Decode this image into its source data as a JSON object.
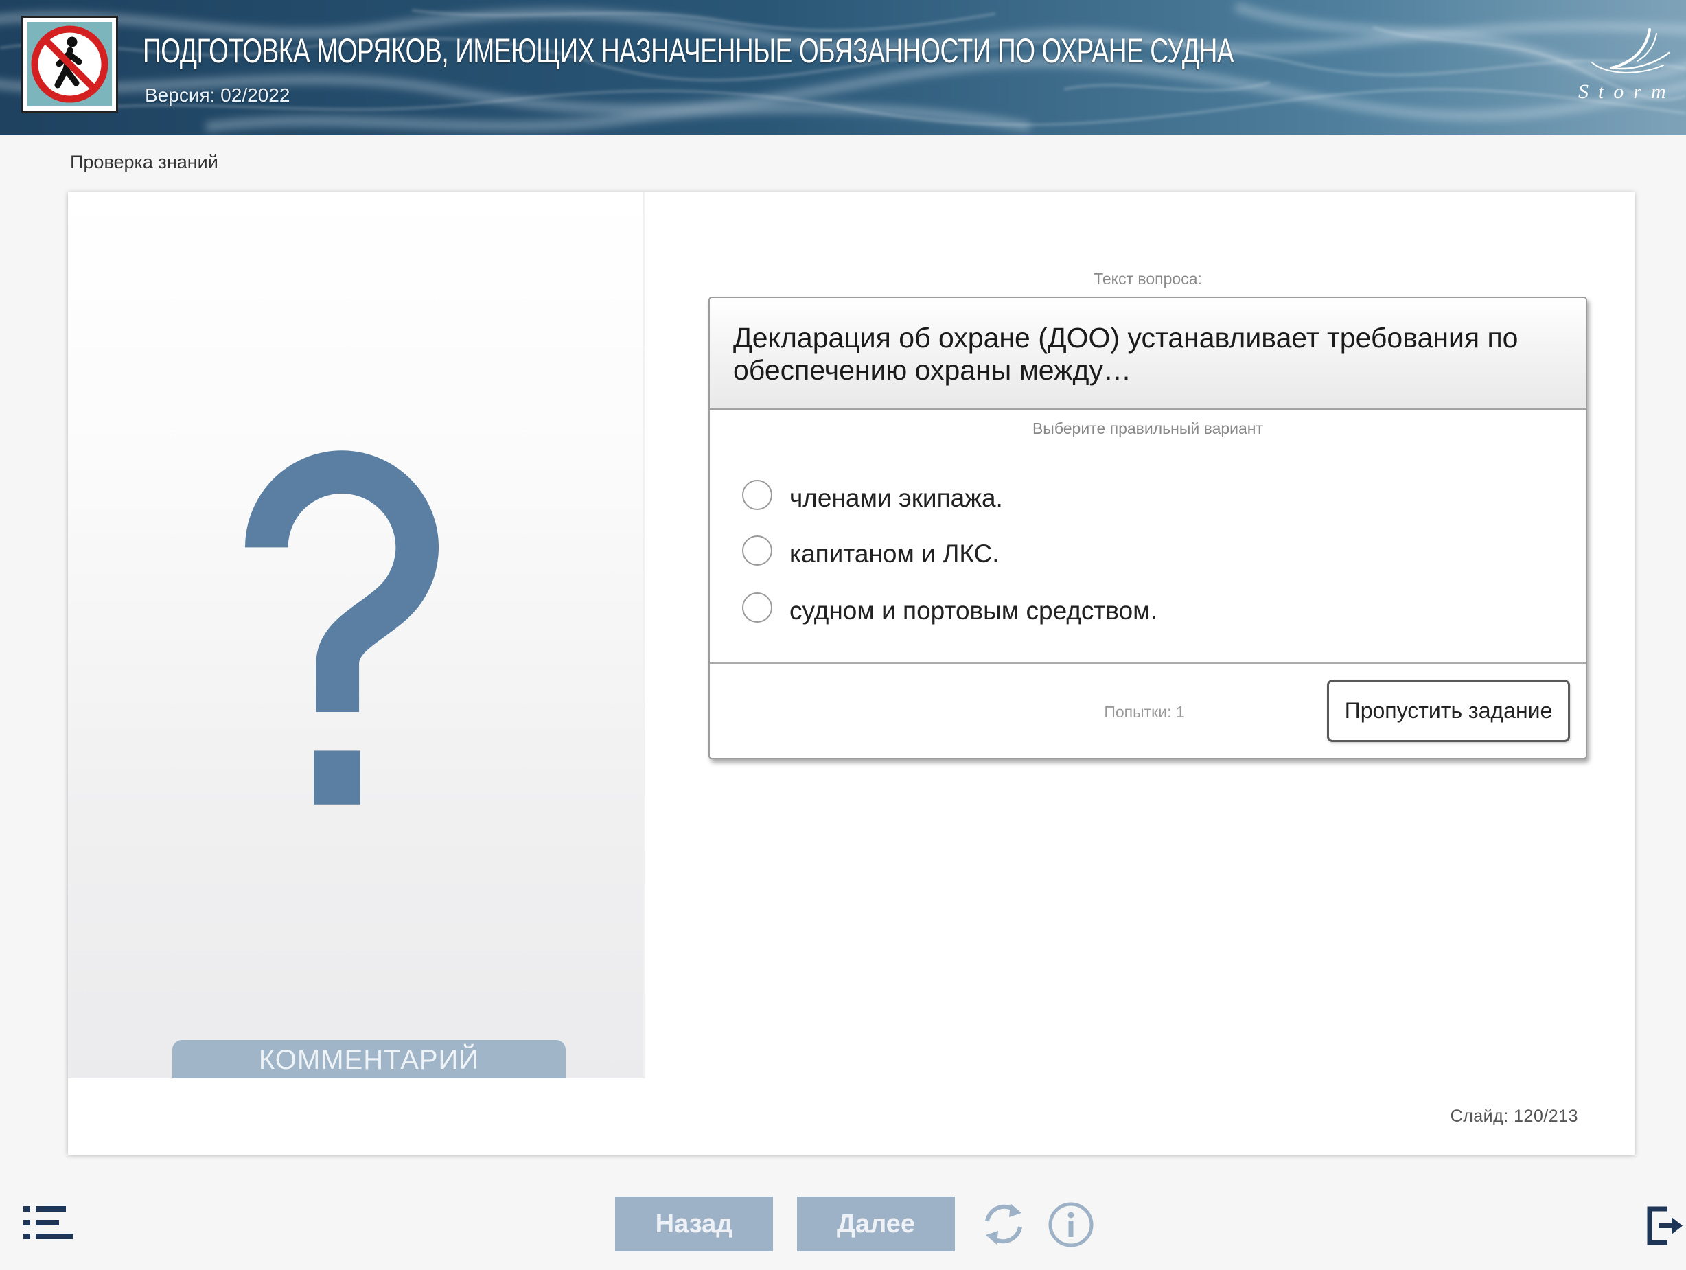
{
  "header": {
    "title": "ПОДГОТОВКА МОРЯКОВ, ИМЕЮЩИХ НАЗНАЧЕННЫЕ ОБЯЗАННОСТИ ПО ОХРАНЕ СУДНА",
    "version": "Версия: 02/2022",
    "course_icon": "no-pedestrian-sign-icon",
    "brand_logo_text": "Storm"
  },
  "section_title": "Проверка знаний",
  "left_panel": {
    "placeholder_icon": "question-mark-icon",
    "comment_tab": "КОММЕНТАРИЙ"
  },
  "question": {
    "caption": "Текст вопроса:",
    "text": "Декларация об охране (ДОО) устанавливает требования по обеспечению охраны между…",
    "instruction": "Выберите правильный вариант",
    "options": [
      {
        "label": "членами экипажа.",
        "selected": false
      },
      {
        "label": "капитаном и ЛКС.",
        "selected": false
      },
      {
        "label": "судном и портовым средством.",
        "selected": false
      }
    ],
    "attempts": "Попытки: 1",
    "skip_label": "Пропустить задание"
  },
  "slide_counter": "Слайд: 120/213",
  "toolbar": {
    "back_label": "Назад",
    "next_label": "Далее",
    "icons": {
      "menu": "menu-list-icon",
      "refresh": "refresh-icon",
      "info": "info-icon",
      "exit": "exit-icon"
    }
  },
  "colors": {
    "page_background": "#f6f6f6",
    "question_mark": "#5a7fa3",
    "nav_button_background": "#9db2c6",
    "comment_tab_background": "#a1b5c8",
    "toolbar_dark_icon": "#1d3557",
    "prohibition_red": "#d42020"
  }
}
